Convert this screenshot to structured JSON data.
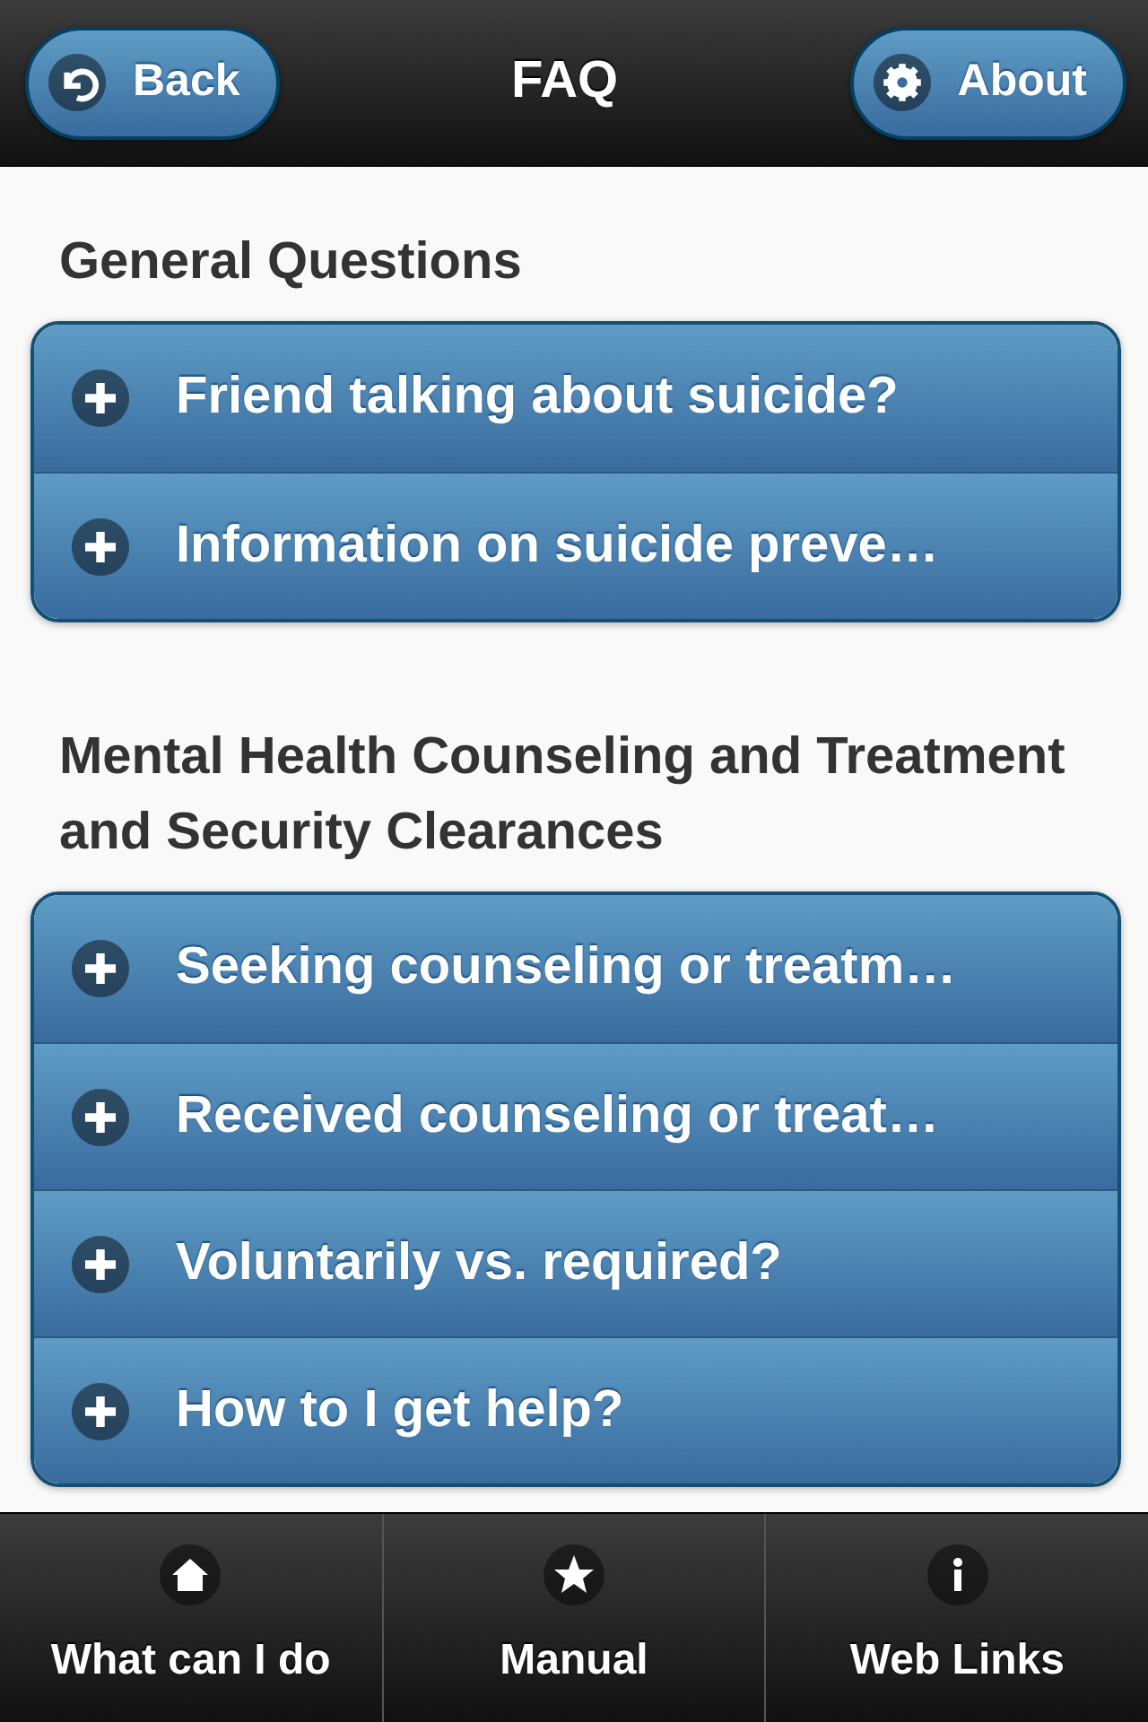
{
  "header": {
    "back": "Back",
    "title": "FAQ",
    "about": "About"
  },
  "sections": [
    {
      "heading": "General Questions",
      "items": [
        {
          "label": "Friend talking about suicide?",
          "expanded": false
        },
        {
          "label": "Information on suicide preve…",
          "expanded": false
        }
      ]
    },
    {
      "heading": "Mental Health Counseling and Treatment and Security Clearances",
      "items": [
        {
          "label": "Seeking counseling or treatm…",
          "expanded": false
        },
        {
          "label": "Received counseling or treat…",
          "expanded": false
        },
        {
          "label": "Voluntarily vs. required?",
          "expanded": false
        },
        {
          "label": "How to I get help?",
          "expanded": false
        }
      ]
    }
  ],
  "tabbar": [
    {
      "label": "What can I do",
      "kind": "home"
    },
    {
      "label": "Manual",
      "kind": "star"
    },
    {
      "label": "Web Links",
      "kind": "info"
    }
  ]
}
